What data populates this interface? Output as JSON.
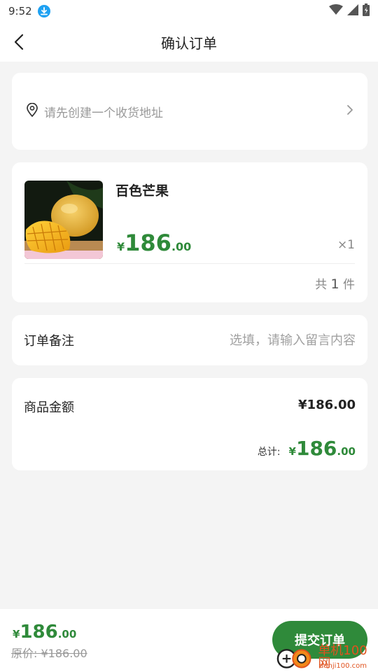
{
  "status_bar": {
    "time": "9:52"
  },
  "header": {
    "title": "确认订单"
  },
  "address": {
    "placeholder": "请先创建一个收货地址"
  },
  "product": {
    "name": "百色芒果",
    "price_symbol": "¥",
    "price_int": "186",
    "price_dec": ".00",
    "quantity": "×1",
    "total_prefix": "共",
    "total_count": "1",
    "total_suffix": "件"
  },
  "remark": {
    "label": "订单备注",
    "placeholder": "选填，请输入留言内容"
  },
  "amount": {
    "label": "商品金额",
    "value": "¥186.00",
    "total_label": "总计:",
    "total_symbol": "¥",
    "total_int": "186",
    "total_dec": ".00"
  },
  "footer": {
    "price_symbol": "¥",
    "price_int": "186",
    "price_dec": ".00",
    "original_price": "原价: ¥186.00",
    "submit_label": "提交订单"
  },
  "watermark": {
    "text": "单机100网",
    "sub": "danji100.com"
  },
  "colors": {
    "accent": "#2f8a3a",
    "background": "#f4f4f4",
    "download_badge": "#1ea1f2"
  },
  "icons": [
    "download-icon",
    "wifi-icon",
    "signal-icon",
    "battery-icon",
    "back-arrow-icon",
    "location-pin-icon",
    "chevron-right-icon"
  ]
}
